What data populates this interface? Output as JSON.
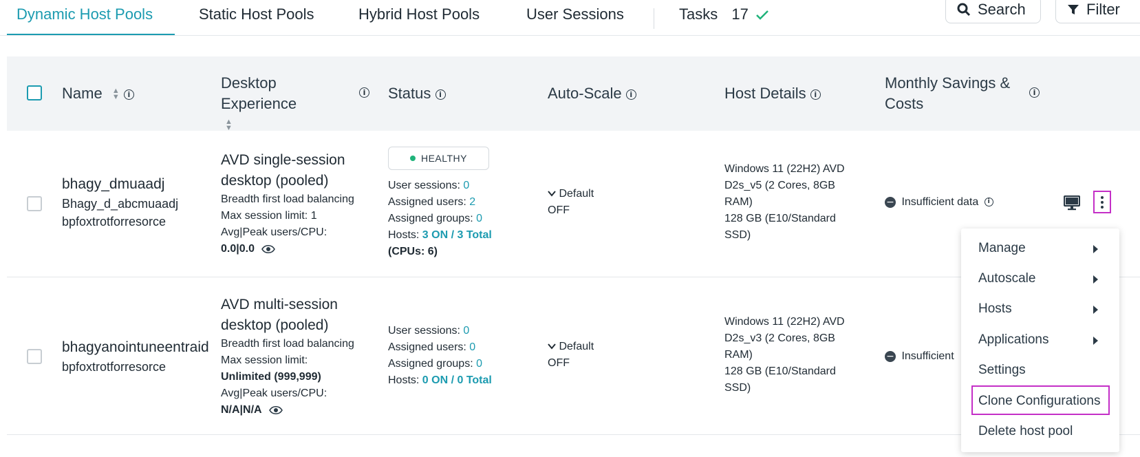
{
  "tabs": [
    {
      "label": "Dynamic Host Pools",
      "active": true
    },
    {
      "label": "Static Host Pools"
    },
    {
      "label": "Hybrid Host Pools"
    },
    {
      "label": "User Sessions"
    }
  ],
  "tasks": {
    "label": "Tasks",
    "count": "17"
  },
  "toolbar": {
    "search_label": "Search",
    "filter_label": "Filter"
  },
  "columns": {
    "name": "Name",
    "desktop_experience": "Desktop Experience",
    "status": "Status",
    "auto_scale": "Auto-Scale",
    "host_details": "Host Details",
    "monthly_savings": "Monthly Savings & Costs"
  },
  "rows": [
    {
      "name": "bhagy_dmuaadj",
      "alias": "Bhagy_d_abcmuaadj",
      "resource": "bpfoxtrotforresorce",
      "experience_title": "AVD single-session desktop (pooled)",
      "load_balancing": "Breadth first load balancing",
      "max_session_label": "Max session limit:",
      "max_session_value": "1",
      "avg_peak_label": "Avg|Peak users/CPU:",
      "avg_peak_value": "0.0|0.0",
      "status_badge": "HEALTHY",
      "user_sessions_label": "User sessions:",
      "user_sessions": "0",
      "assigned_users_label": "Assigned users:",
      "assigned_users": "2",
      "assigned_groups_label": "Assigned groups:",
      "assigned_groups": "0",
      "hosts_label": "Hosts:",
      "hosts": "3 ON / 3 Total",
      "cpus": "(CPUs: 6)",
      "autoscale_profile": "Default",
      "autoscale_state": "OFF",
      "host_os": "Windows 11 (22H2) AVD",
      "host_vm": "D2s_v5 (2 Cores, 8GB",
      "host_ram": "RAM)",
      "host_disk": "128 GB (E10/Standard",
      "host_disk2": "SSD)",
      "savings": "Insufficient data"
    },
    {
      "name": "bhagyanointuneentraid",
      "resource": "bpfoxtrotforresorce",
      "experience_title": "AVD multi-session desktop (pooled)",
      "load_balancing": "Breadth first load balancing",
      "max_session_label": "Max session limit:",
      "max_session_value": "Unlimited (999,999)",
      "avg_peak_label": "Avg|Peak users/CPU:",
      "avg_peak_value": "N/A|N/A",
      "user_sessions_label": "User sessions:",
      "user_sessions": "0",
      "assigned_users_label": "Assigned users:",
      "assigned_users": "0",
      "assigned_groups_label": "Assigned groups:",
      "assigned_groups": "0",
      "hosts_label": "Hosts:",
      "hosts": "0 ON / 0 Total",
      "autoscale_profile": "Default",
      "autoscale_state": "OFF",
      "host_os": "Windows 11 (22H2) AVD",
      "host_vm": "D2s_v3 (2 Cores, 8GB",
      "host_ram": "RAM)",
      "host_disk": "128 GB (E10/Standard",
      "host_disk2": "SSD)",
      "savings": "Insufficient"
    }
  ],
  "context_menu": {
    "items": [
      {
        "label": "Manage",
        "submenu": true
      },
      {
        "label": "Autoscale",
        "submenu": true
      },
      {
        "label": "Hosts",
        "submenu": true
      },
      {
        "label": "Applications",
        "submenu": true
      },
      {
        "label": "Settings"
      },
      {
        "label": "Clone Configurations",
        "highlighted": true
      },
      {
        "label": "Delete host pool"
      }
    ]
  },
  "colors": {
    "accent": "#1c9bb0",
    "highlight": "#c42fc7",
    "healthy": "#1fb37a"
  }
}
